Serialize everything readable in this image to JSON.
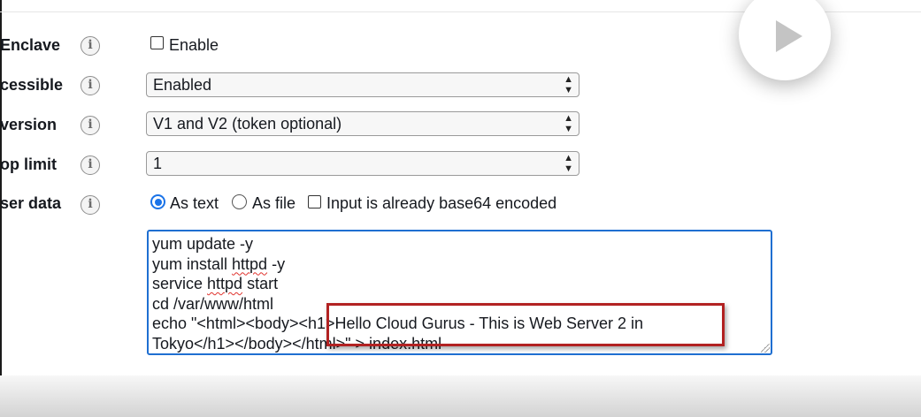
{
  "fields": {
    "enclave": {
      "label": "Enclave",
      "checkbox_label": "Enable",
      "checked": false
    },
    "accessible": {
      "label": "cessible",
      "value": "Enabled"
    },
    "version": {
      "label": "version",
      "value": "V1 and V2 (token optional)"
    },
    "hop_limit": {
      "label": "op limit",
      "value": "1"
    },
    "user_data": {
      "label": "ser data",
      "options": {
        "as_text": "As text",
        "as_file": "As file",
        "base64": "Input is already base64 encoded"
      },
      "selected": "As text",
      "lines": [
        "yum update -y",
        "yum install ",
        "httpd",
        " -y",
        "service ",
        "httpd",
        " start",
        "cd /var/www/html",
        "echo \"<html><body><h1>Hello Cloud Gurus - This is Web Server 2 in",
        "Tokyo</h1></body></html>\" > index.html"
      ]
    }
  },
  "icons": {
    "info": "info-icon",
    "play": "play-icon",
    "select_arrows": "up-down-arrows-icon"
  },
  "colors": {
    "accent": "#1f6fd1",
    "highlight": "#b22222"
  }
}
